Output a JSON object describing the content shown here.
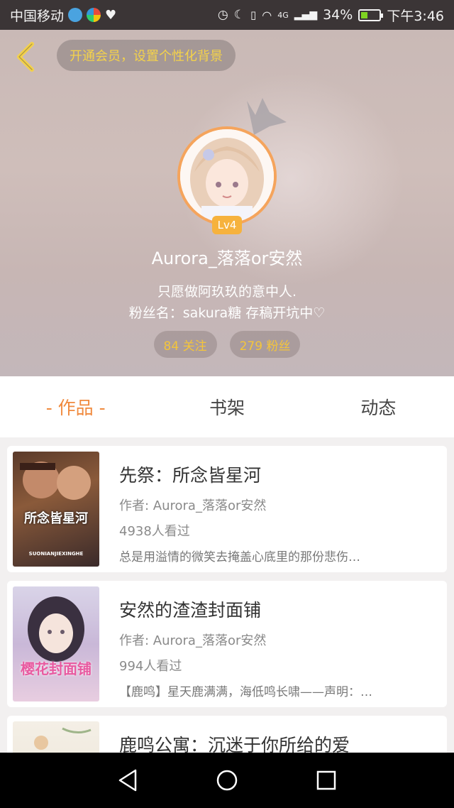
{
  "status_bar": {
    "carrier": "中国移动",
    "battery": "34%",
    "network": "4G",
    "time": "下午3:46"
  },
  "header": {
    "vip_text": "开通会员，设置个性化背景",
    "level": "Lv4",
    "username": "Aurora_落落or安然",
    "bio_line1": "只愿做阿玖玖的意中人.",
    "bio_line2": "粉丝名：sakura糖 存稿开坑中♡",
    "following": "84 关注",
    "followers": "279 粉丝"
  },
  "tabs": [
    {
      "label": "- 作品 -",
      "active": true
    },
    {
      "label": "书架",
      "active": false
    },
    {
      "label": "动态",
      "active": false
    }
  ],
  "works": [
    {
      "title": "先祭：所念皆星河",
      "author": "作者: Aurora_落落or安然",
      "views": "4938人看过",
      "desc": "总是用溢情的微笑去掩盖心底里的那份悲伤…",
      "cover_text": "所念皆星河",
      "cover_sub": "SUONIANJIEXINGHE"
    },
    {
      "title": "安然的渣渣封面铺",
      "author": "作者: Aurora_落落or安然",
      "views": "994人看过",
      "desc": "【鹿鸣】星天鹿满满，海低鸣长啸——声明：…",
      "cover_text": "樱花封面铺",
      "cover_sub": ""
    },
    {
      "title": "鹿鸣公寓：沉迷于你所给的爱",
      "author": "",
      "views": "",
      "desc": "",
      "cover_text": "",
      "cover_sub": ""
    }
  ],
  "colors": {
    "accent": "#f08a3e",
    "gold": "#f4c53a",
    "status_bar": "#3b3536"
  },
  "icons": [
    "back-chevron-icon",
    "crown-icon",
    "nav-back-icon",
    "nav-home-icon",
    "nav-recents-icon"
  ]
}
